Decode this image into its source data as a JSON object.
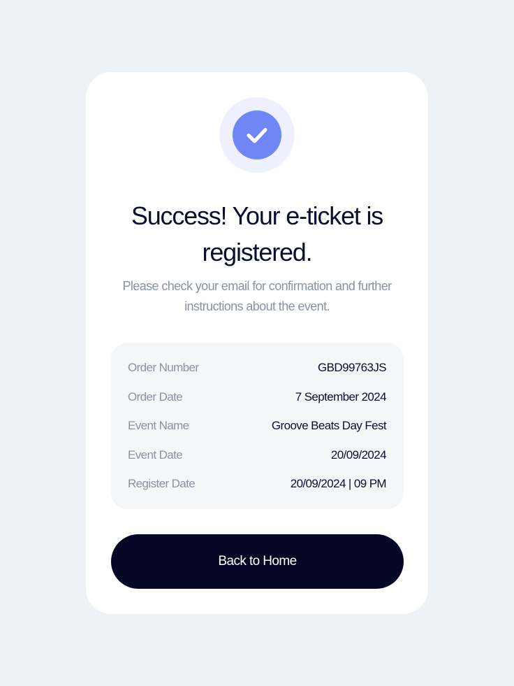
{
  "card": {
    "icon": "check-icon",
    "title_line1": "Success! Your e-ticket is",
    "title_line2": "registered.",
    "subtitle_line1": "Please check your email for confirmation and further",
    "subtitle_line2": "instructions about the event."
  },
  "details": [
    {
      "label": "Order Number",
      "value": "GBD99763JS"
    },
    {
      "label": "Order Date",
      "value": "7 September 2024"
    },
    {
      "label": "Event Name",
      "value": "Groove Beats Day Fest"
    },
    {
      "label": "Event Date",
      "value": "20/09/2024"
    },
    {
      "label": "Register Date",
      "value": "20/09/2024 | 09 PM"
    }
  ],
  "button": {
    "label": "Back to Home"
  },
  "colors": {
    "background": "#eef1f5",
    "card": "#ffffff",
    "accent": "#6f86f5",
    "accent_halo": "#eef1fd",
    "button": "#040726",
    "text_primary": "#0b0f2e",
    "text_secondary": "#8b929f"
  }
}
